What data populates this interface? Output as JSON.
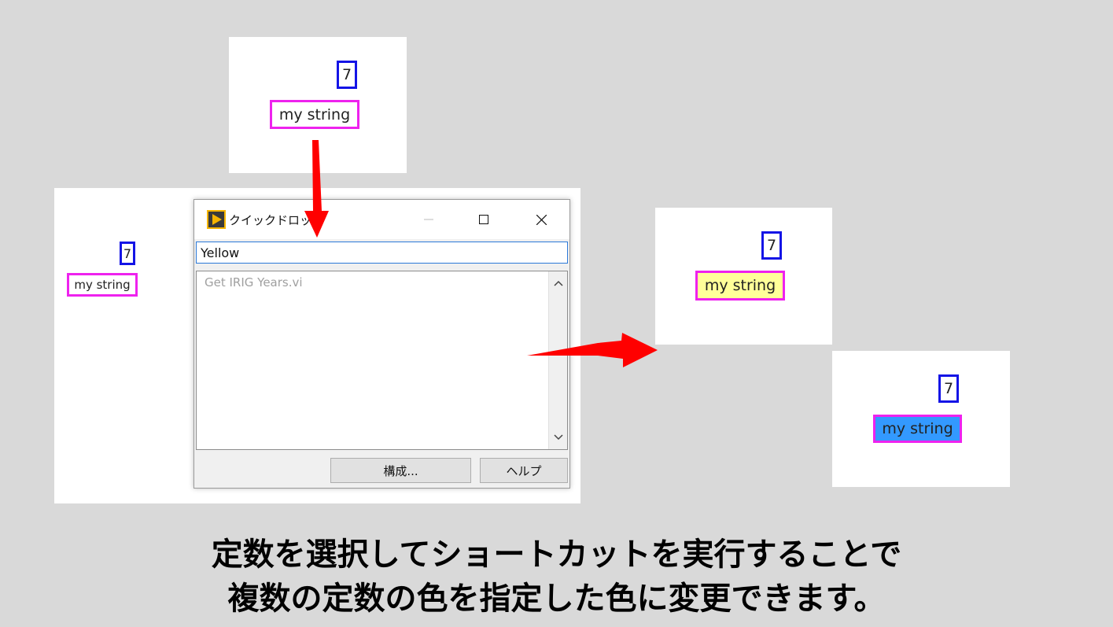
{
  "panels": {
    "top": {
      "number": "7",
      "string": "my string"
    },
    "left": {
      "number": "7",
      "string": "my string"
    },
    "yellow_result": {
      "number": "7",
      "string": "my string",
      "string_bg": "#ffff99"
    },
    "blue_result": {
      "number": "7",
      "string": "my string",
      "string_bg": "#3399ff"
    }
  },
  "dialog": {
    "title": "クイックドロップ",
    "search_value": "Yellow",
    "results": [
      "Get IRIG Years.vi"
    ],
    "buttons": {
      "configure": "構成...",
      "help": "ヘルプ"
    },
    "icons": [
      "labview-icon",
      "minimize-icon",
      "maximize-icon",
      "close-icon",
      "scroll-up-icon",
      "scroll-down-icon"
    ]
  },
  "colors": {
    "numeric_border": "#1414e6",
    "string_border": "#ee22ee",
    "arrow": "#ff0000"
  },
  "caption": {
    "line1": "定数を選択してショートカットを実行することで",
    "line2": "複数の定数の色を指定した色に変更できます。"
  }
}
